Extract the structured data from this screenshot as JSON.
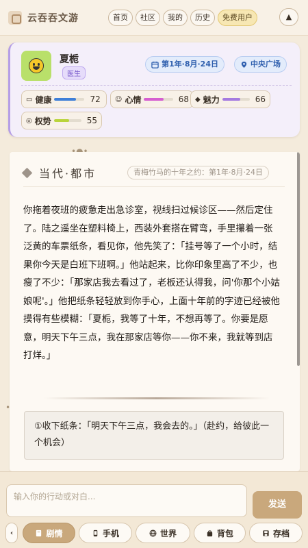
{
  "app": {
    "name": "云吞吞文游"
  },
  "nav": {
    "items": [
      "首页",
      "社区",
      "我的",
      "历史"
    ],
    "vip": "免费用户",
    "up_icon": "▲"
  },
  "character": {
    "name": "夏栀",
    "role": "医生",
    "date": "第1年·8月·24日",
    "location": "中央广场",
    "stats": [
      {
        "label": "健康",
        "value": 72,
        "color": "#3f7fd8",
        "icon": "card-icon"
      },
      {
        "label": "心情",
        "value": 68,
        "color": "#d55fd0",
        "icon": "smile-icon"
      },
      {
        "label": "魅力",
        "value": 66,
        "color": "#a57be0",
        "icon": "gem-icon"
      },
      {
        "label": "权势",
        "value": 55,
        "color": "#b9d43c",
        "icon": "medal-icon"
      }
    ]
  },
  "story": {
    "section": "当代·都市",
    "chapter": "青梅竹马的十年之约：第1年·8月·24日",
    "text": "你拖着夜班的疲惫走出急诊室，视线扫过候诊区——然后定住了。陆之遥坐在塑料椅上，西装外套搭在臂弯，手里攥着一张泛黄的车票纸条，看见你，他先笑了：「挂号等了一个小时，结果你今天是白班下班啊。」他站起来，比你印象里高了不少，也瘦了不少：「那家店我去看过了，老板还认得我，问'你那个小姑娘呢'。」他把纸条轻轻放到你手心，上面十年前的字迹已经被他摸得有些模糊：「夏栀，我等了十年，不想再等了。你要是愿意，明天下午三点，我在那家店等你——你不来，我就等到店打烊。」",
    "choice": "①收下纸条：「明天下午三点，我会去的。」（赴约，给彼此一个机会）"
  },
  "input": {
    "placeholder": "输入你的行动或对白...",
    "send": "发送"
  },
  "tabs": [
    {
      "label": "剧情",
      "icon": "book-icon",
      "active": true
    },
    {
      "label": "手机",
      "icon": "phone-icon",
      "active": false
    },
    {
      "label": "世界",
      "icon": "globe-icon",
      "active": false
    },
    {
      "label": "背包",
      "icon": "bag-icon",
      "active": false
    },
    {
      "label": "存档",
      "icon": "save-icon",
      "active": false
    }
  ],
  "tab_left_icon": "‹"
}
